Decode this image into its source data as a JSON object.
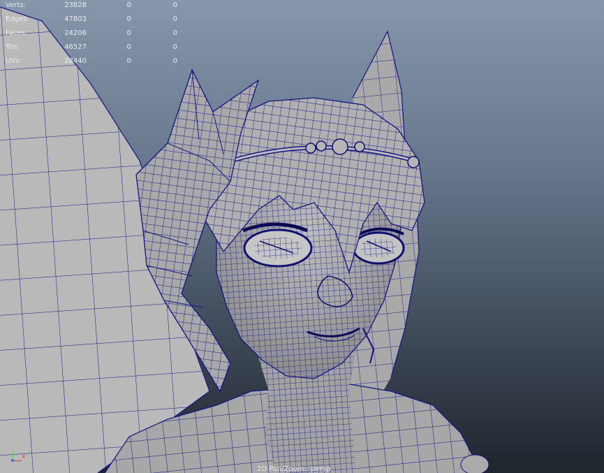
{
  "stats": [
    {
      "label": "Verts:",
      "values": [
        "23828",
        "0",
        "0"
      ]
    },
    {
      "label": "Edges:",
      "values": [
        "47803",
        "0",
        "0"
      ]
    },
    {
      "label": "Faces:",
      "values": [
        "24206",
        "0",
        "0"
      ]
    },
    {
      "label": "Tris:",
      "values": [
        "46527",
        "0",
        "0"
      ]
    },
    {
      "label": "UVs:",
      "values": [
        "28440",
        "0",
        "0"
      ]
    }
  ],
  "status_text": "2D Pan/Zoom : persp",
  "axis": {
    "y_label": "y",
    "x_label": "x"
  },
  "colors": {
    "background_top": "#8796aa",
    "background_bottom": "#1f252d",
    "mesh_fill": "#b4b4b4",
    "wireframe": "#14147e"
  }
}
